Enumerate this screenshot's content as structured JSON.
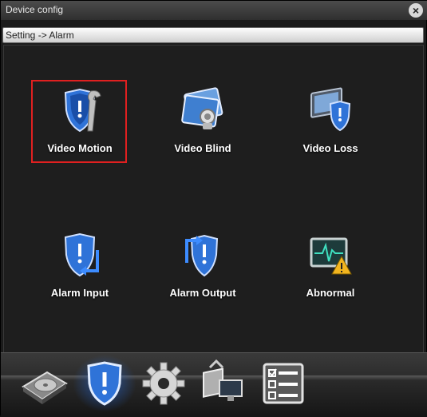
{
  "window": {
    "title": "Device config"
  },
  "breadcrumb": {
    "text": "Setting -> Alarm"
  },
  "tiles": [
    {
      "label": "Video Motion",
      "icon": "shield-wrench-icon",
      "selected": true
    },
    {
      "label": "Video Blind",
      "icon": "blinded-camera-icon",
      "selected": false
    },
    {
      "label": "Video Loss",
      "icon": "monitor-shield-icon",
      "selected": false
    },
    {
      "label": "Alarm Input",
      "icon": "shield-arrow-in-icon",
      "selected": false
    },
    {
      "label": "Alarm Output",
      "icon": "shield-arrow-out-icon",
      "selected": false
    },
    {
      "label": "Abnormal",
      "icon": "heart-monitor-warning-icon",
      "selected": false
    }
  ],
  "dock": [
    {
      "icon": "hard-disk-icon"
    },
    {
      "icon": "alarm-shield-icon",
      "active": true
    },
    {
      "icon": "gear-icon"
    },
    {
      "icon": "network-icon"
    },
    {
      "icon": "checklist-icon"
    }
  ],
  "colors": {
    "selection": "#e02020",
    "shield": "#2f73d8",
    "accent_glow": "#2878ff"
  }
}
